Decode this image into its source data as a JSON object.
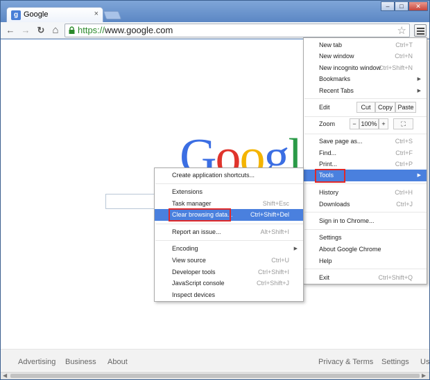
{
  "tab": {
    "favicon": "g",
    "title": "Google",
    "close": "×"
  },
  "window_buttons": {
    "minimize": "–",
    "maximize": "□",
    "close": "✕"
  },
  "toolbar": {
    "back": "←",
    "forward": "→",
    "reload": "↻",
    "home": "⌂"
  },
  "omnibox": {
    "scheme": "https://",
    "rest": "www.google.com",
    "star": "☆"
  },
  "logo": {
    "letters": [
      "G",
      "o",
      "o",
      "g",
      "l"
    ],
    "colors": [
      "#3b6ee3",
      "#e0342c",
      "#f4b400",
      "#3b6ee3",
      "#2a9a47"
    ]
  },
  "footer": {
    "left": [
      "Advertising",
      "Business",
      "About"
    ],
    "right": [
      "Privacy & Terms",
      "Settings",
      "Us"
    ]
  },
  "chrome_menu": {
    "new_tab": {
      "label": "New tab",
      "shortcut": "Ctrl+T"
    },
    "new_window": {
      "label": "New window",
      "shortcut": "Ctrl+N"
    },
    "incognito": {
      "label": "New incognito window",
      "shortcut": "Ctrl+Shift+N"
    },
    "bookmarks": {
      "label": "Bookmarks",
      "arrow": "▶"
    },
    "recent_tabs": {
      "label": "Recent Tabs",
      "arrow": "▶"
    },
    "edit": {
      "label": "Edit",
      "cut": "Cut",
      "copy": "Copy",
      "paste": "Paste"
    },
    "zoom": {
      "label": "Zoom",
      "minus": "−",
      "value": "100%",
      "plus": "+",
      "fullscreen": "⛶"
    },
    "save_page": {
      "label": "Save page as...",
      "shortcut": "Ctrl+S"
    },
    "find": {
      "label": "Find...",
      "shortcut": "Ctrl+F"
    },
    "print": {
      "label": "Print...",
      "shortcut": "Ctrl+P"
    },
    "tools": {
      "label": "Tools",
      "arrow": "▶"
    },
    "history": {
      "label": "History",
      "shortcut": "Ctrl+H"
    },
    "downloads": {
      "label": "Downloads",
      "shortcut": "Ctrl+J"
    },
    "sign_in": {
      "label": "Sign in to Chrome..."
    },
    "settings": {
      "label": "Settings"
    },
    "about": {
      "label": "About Google Chrome"
    },
    "help": {
      "label": "Help"
    },
    "exit": {
      "label": "Exit",
      "shortcut": "Ctrl+Shift+Q"
    }
  },
  "tools_menu": {
    "app_shortcuts": {
      "label": "Create application shortcuts..."
    },
    "extensions": {
      "label": "Extensions"
    },
    "task_manager": {
      "label": "Task manager",
      "shortcut": "Shift+Esc"
    },
    "clear_data": {
      "label": "Clear browsing data...",
      "shortcut": "Ctrl+Shift+Del"
    },
    "report_issue": {
      "label": "Report an issue...",
      "shortcut": "Alt+Shift+I"
    },
    "encoding": {
      "label": "Encoding",
      "arrow": "▶"
    },
    "view_source": {
      "label": "View source",
      "shortcut": "Ctrl+U"
    },
    "dev_tools": {
      "label": "Developer tools",
      "shortcut": "Ctrl+Shift+I"
    },
    "js_console": {
      "label": "JavaScript console",
      "shortcut": "Ctrl+Shift+J"
    },
    "inspect_devices": {
      "label": "Inspect devices"
    }
  },
  "colors": {
    "highlight": "#4a80de",
    "annotation": "#e02828"
  },
  "scrollbar": {
    "left_arrow": "◀",
    "right_arrow": "▶"
  }
}
